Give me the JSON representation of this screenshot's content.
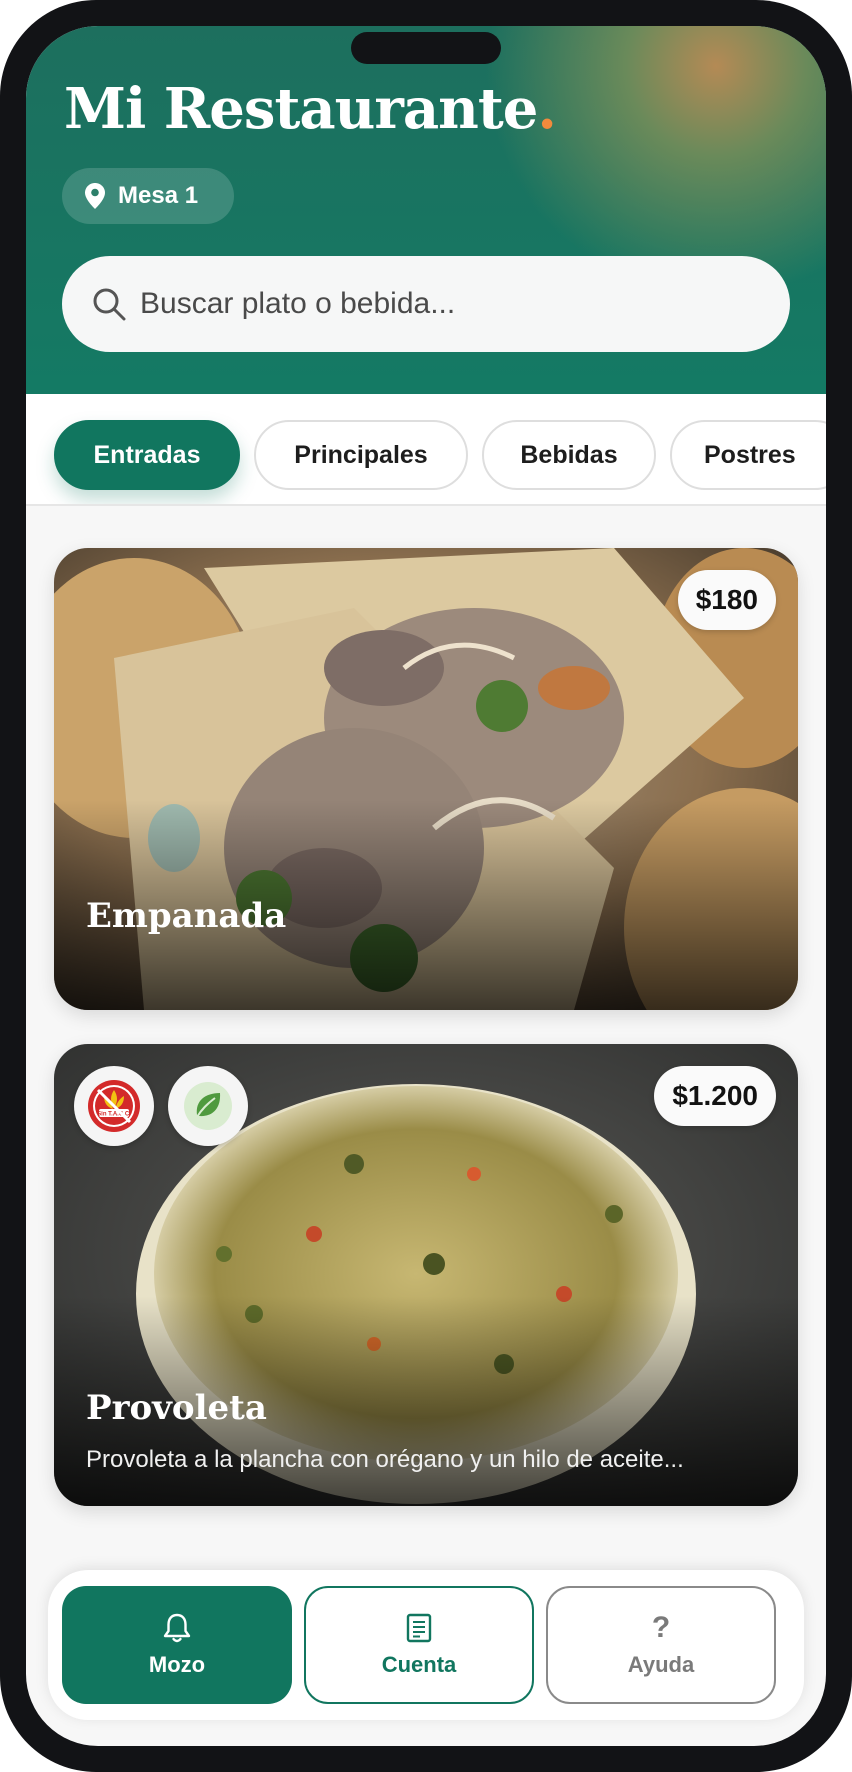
{
  "app": {
    "title": "Mi Restaurante",
    "title_dot": ".",
    "table_label": "Mesa 1"
  },
  "search": {
    "placeholder": "Buscar plato o bebida...",
    "value": ""
  },
  "categories": [
    {
      "label": "Entradas",
      "active": true
    },
    {
      "label": "Principales",
      "active": false
    },
    {
      "label": "Bebidas",
      "active": false
    },
    {
      "label": "Postres",
      "active": false
    }
  ],
  "dishes": [
    {
      "name": "Empanada",
      "price": "$180",
      "description": "",
      "badges": []
    },
    {
      "name": "Provoleta",
      "price": "$1.200",
      "description": "Provoleta a la plancha con orégano y un hilo de aceite...",
      "badges": [
        {
          "icon": "sin-tacc-icon",
          "text": "Sin T.A.C.C."
        },
        {
          "icon": "leaf-icon"
        }
      ]
    }
  ],
  "bottom_nav": [
    {
      "label": "Mozo",
      "icon": "bell-icon",
      "active": true
    },
    {
      "label": "Cuenta",
      "icon": "receipt-icon",
      "active": false
    },
    {
      "label": "Ayuda",
      "icon": "help-icon",
      "active": false
    }
  ],
  "colors": {
    "primary": "#11765f",
    "accent": "#f28a3c",
    "background": "#f7f7f7"
  }
}
